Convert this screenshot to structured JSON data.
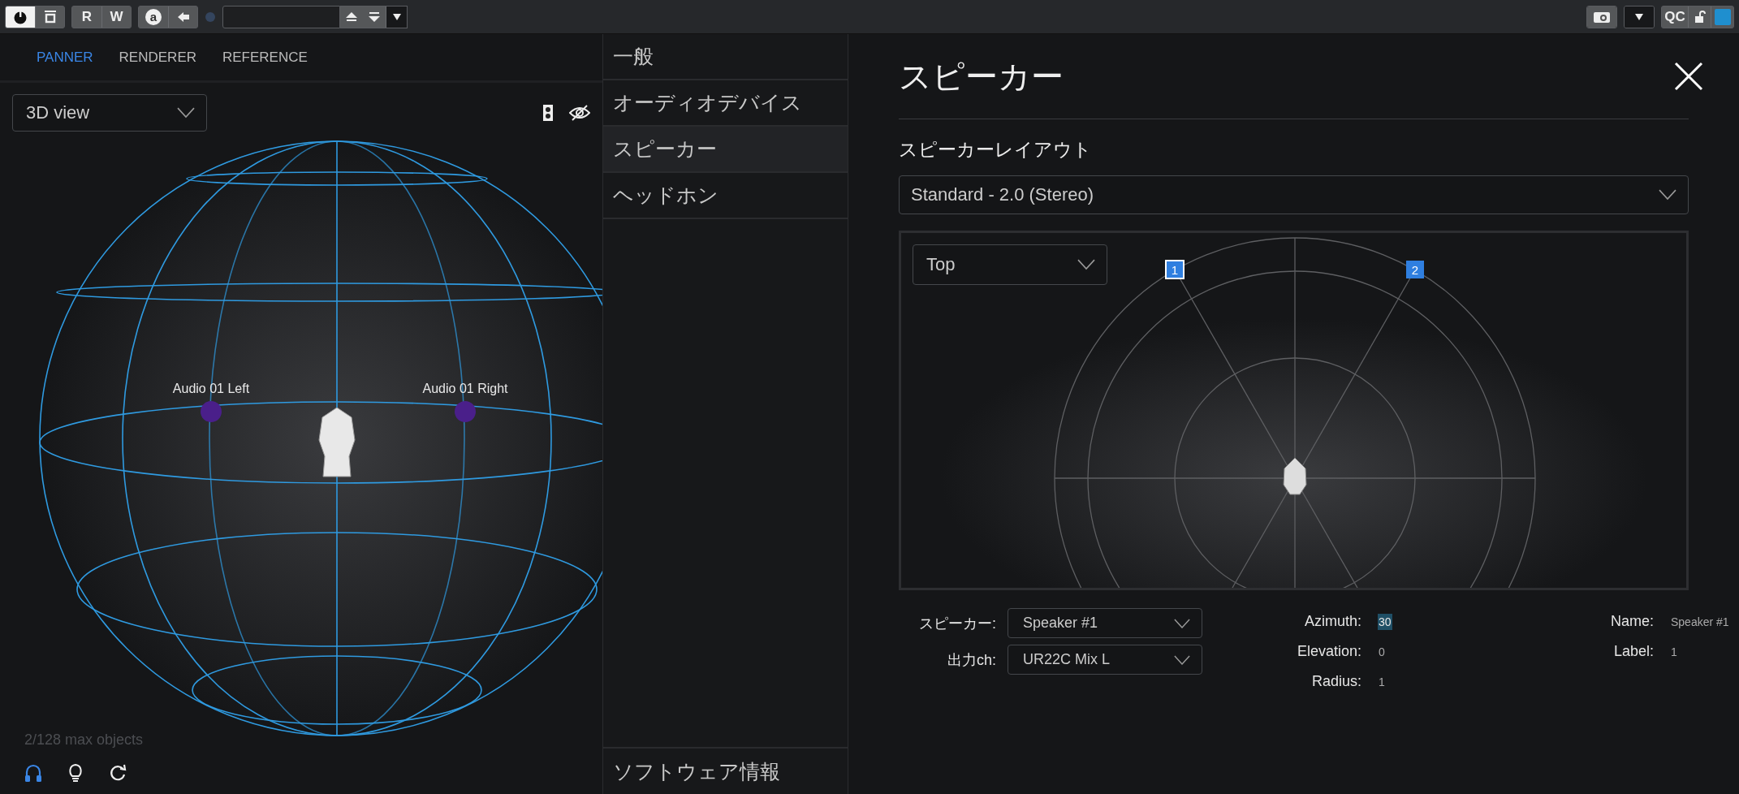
{
  "toolbar": {
    "power_active": true,
    "read_label": "R",
    "write_label": "W",
    "auto_label": "a",
    "qc_label": "QC"
  },
  "panner": {
    "tabs": [
      {
        "label": "PANNER",
        "selected": true
      },
      {
        "label": "RENDERER",
        "selected": false
      },
      {
        "label": "REFERENCE",
        "selected": false
      }
    ],
    "view_select": "3D view",
    "objects": [
      {
        "label": "Audio 01 Left"
      },
      {
        "label": "Audio 01 Right"
      }
    ],
    "object_count": "2/128 max objects",
    "footer_icons": [
      {
        "kind": "headphones",
        "selected": true
      },
      {
        "kind": "bulb",
        "selected": false
      },
      {
        "kind": "refresh",
        "selected": false
      }
    ]
  },
  "settings_menu": {
    "items": [
      {
        "label": "一般",
        "selected": false
      },
      {
        "label": "オーディオデバイス",
        "selected": false
      },
      {
        "label": "スピーカー",
        "selected": true
      },
      {
        "label": "ヘッドホン",
        "selected": false
      }
    ],
    "footer": "ソフトウェア情報"
  },
  "speaker_page": {
    "title": "スピーカー",
    "layout_label": "スピーカーレイアウト",
    "layout": "Standard - 2.0 (Stereo)",
    "view_select": "Top",
    "speakers": [
      {
        "label": "1",
        "selected": true
      },
      {
        "label": "2",
        "selected": false
      }
    ],
    "selects": [
      {
        "label": "スピーカー:",
        "value": "Speaker #1"
      },
      {
        "label": "出力ch:",
        "value": "UR22C Mix L"
      }
    ],
    "position": [
      {
        "label": "Azimuth:",
        "value": "30",
        "highlighted": true
      },
      {
        "label": "Elevation:",
        "value": "0",
        "highlighted": false
      },
      {
        "label": "Radius:",
        "value": "1",
        "highlighted": false
      }
    ],
    "info": [
      {
        "label": "Name:",
        "value": "Speaker #1"
      },
      {
        "label": "Label:",
        "value": "1"
      }
    ]
  }
}
